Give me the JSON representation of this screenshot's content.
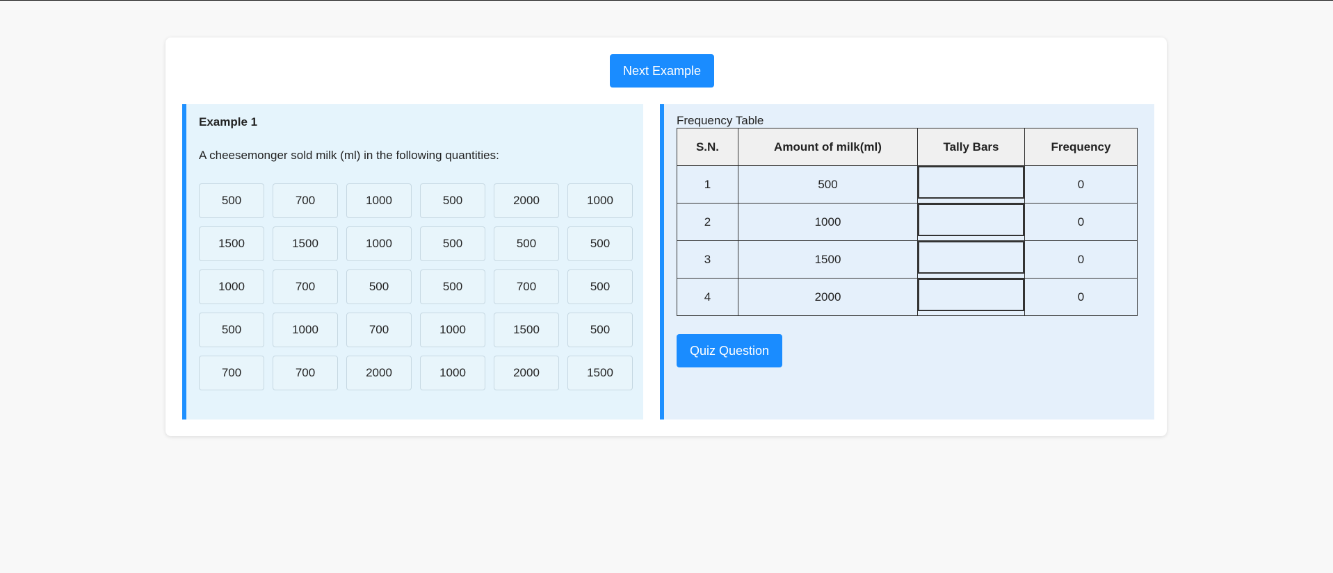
{
  "header": {
    "next_label": "Next Example"
  },
  "example": {
    "title": "Example 1",
    "description": "A cheesemonger sold milk (ml) in the following quantities:",
    "values": [
      [
        "500",
        "700",
        "1000",
        "500",
        "2000",
        "1000"
      ],
      [
        "1500",
        "1500",
        "1000",
        "500",
        "500",
        "500"
      ],
      [
        "1000",
        "700",
        "500",
        "500",
        "700",
        "500"
      ],
      [
        "500",
        "1000",
        "700",
        "1000",
        "1500",
        "500"
      ],
      [
        "700",
        "700",
        "2000",
        "1000",
        "2000",
        "1500"
      ]
    ]
  },
  "frequency_table": {
    "caption": "Frequency Table",
    "headers": [
      "S.N.",
      "Amount of milk(ml)",
      "Tally Bars",
      "Frequency"
    ],
    "rows": [
      {
        "sn": "1",
        "amount": "500",
        "tally": "",
        "frequency": "0"
      },
      {
        "sn": "2",
        "amount": "1000",
        "tally": "",
        "frequency": "0"
      },
      {
        "sn": "3",
        "amount": "1500",
        "tally": "",
        "frequency": "0"
      },
      {
        "sn": "4",
        "amount": "2000",
        "tally": "",
        "frequency": "0"
      }
    ]
  },
  "quiz": {
    "label": "Quiz Question"
  },
  "colors": {
    "accent": "#1e90ff",
    "button": "#1a8cff",
    "left_panel_bg": "#e5f4fc",
    "right_panel_bg": "#e5f0fb"
  }
}
